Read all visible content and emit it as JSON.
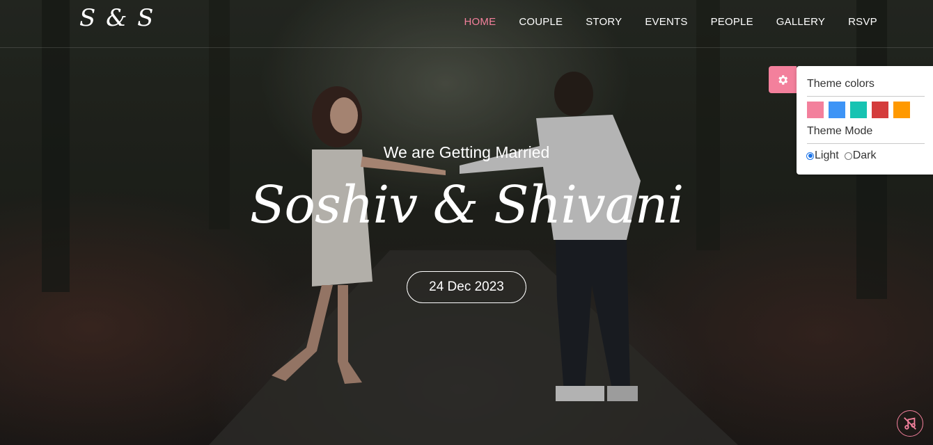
{
  "nav": {
    "logo": "S & S",
    "items": [
      {
        "label": "HOME",
        "active": true
      },
      {
        "label": "COUPLE"
      },
      {
        "label": "STORY"
      },
      {
        "label": "EVENTS"
      },
      {
        "label": "PEOPLE"
      },
      {
        "label": "GALLERY"
      },
      {
        "label": "RSVP"
      }
    ]
  },
  "hero": {
    "subtitle": "We are Getting Married",
    "names": "Soshiv & Shivani",
    "date": "24 Dec 2023"
  },
  "theme_panel": {
    "colors_title": "Theme colors",
    "swatches": [
      "#f3809c",
      "#3d94f6",
      "#17c3b2",
      "#d43c3c",
      "#ff9900"
    ],
    "mode_title": "Theme Mode",
    "modes": [
      {
        "label": "Light",
        "checked": true
      },
      {
        "label": "Dark",
        "checked": false
      }
    ],
    "accent": "#f3809c",
    "gear_icon": "gear-icon"
  },
  "music": {
    "icon": "music-off-icon"
  }
}
